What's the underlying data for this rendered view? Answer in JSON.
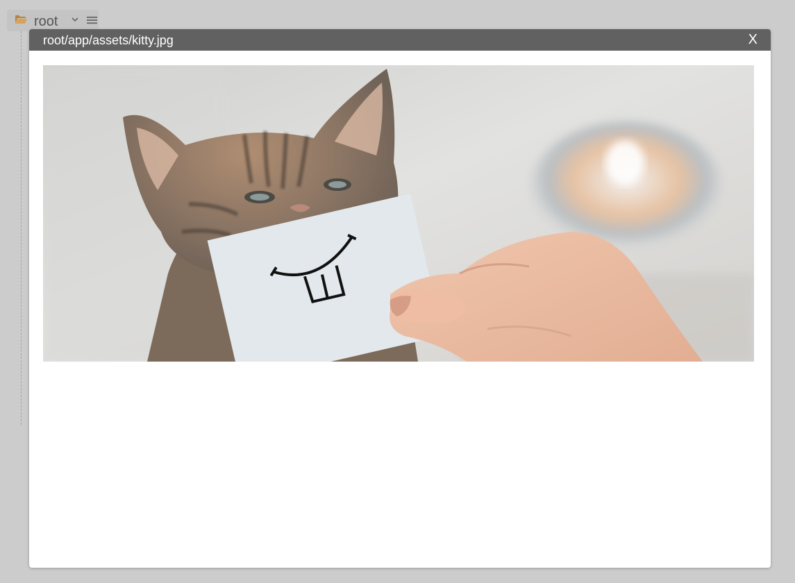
{
  "tree": {
    "root_label": "root",
    "icons": {
      "folder": "folder-open-icon",
      "chevron": "chevron-down-icon",
      "menu": "hamburger-menu-icon"
    },
    "folder_color": "#d9a25a"
  },
  "modal": {
    "title": "root/app/assets/kitty.jpg",
    "close_label": "X",
    "header_color": "#616161"
  },
  "image": {
    "alt": "Kitten holding a card with a drawn buck-tooth smile"
  }
}
